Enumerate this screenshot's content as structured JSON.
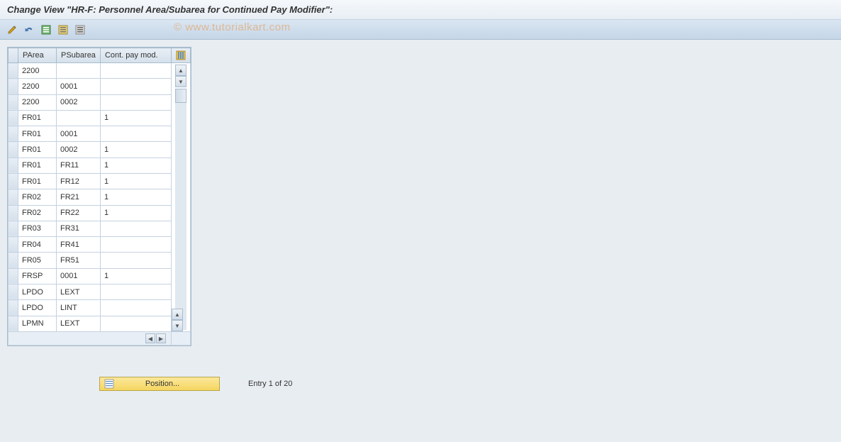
{
  "header": {
    "title": "Change View \"HR-F: Personnel Area/Subarea for Continued Pay Modifier\":"
  },
  "watermark": "© www.tutorialkart.com",
  "table": {
    "columns": {
      "parea": "PArea",
      "psubarea": "PSubarea",
      "contpay": "Cont. pay mod."
    },
    "rows": [
      {
        "parea": "2200",
        "psubarea": "",
        "contpay": ""
      },
      {
        "parea": "2200",
        "psubarea": "0001",
        "contpay": ""
      },
      {
        "parea": "2200",
        "psubarea": "0002",
        "contpay": ""
      },
      {
        "parea": "FR01",
        "psubarea": "",
        "contpay": "1"
      },
      {
        "parea": "FR01",
        "psubarea": "0001",
        "contpay": ""
      },
      {
        "parea": "FR01",
        "psubarea": "0002",
        "contpay": "1"
      },
      {
        "parea": "FR01",
        "psubarea": "FR11",
        "contpay": "1"
      },
      {
        "parea": "FR01",
        "psubarea": "FR12",
        "contpay": "1"
      },
      {
        "parea": "FR02",
        "psubarea": "FR21",
        "contpay": "1"
      },
      {
        "parea": "FR02",
        "psubarea": "FR22",
        "contpay": "1"
      },
      {
        "parea": "FR03",
        "psubarea": "FR31",
        "contpay": ""
      },
      {
        "parea": "FR04",
        "psubarea": "FR41",
        "contpay": ""
      },
      {
        "parea": "FR05",
        "psubarea": "FR51",
        "contpay": ""
      },
      {
        "parea": "FRSP",
        "psubarea": "0001",
        "contpay": "1"
      },
      {
        "parea": "LPDO",
        "psubarea": "LEXT",
        "contpay": ""
      },
      {
        "parea": "LPDO",
        "psubarea": "LINT",
        "contpay": ""
      },
      {
        "parea": "LPMN",
        "psubarea": "LEXT",
        "contpay": ""
      }
    ]
  },
  "footer": {
    "position_label": "Position...",
    "entry_text": "Entry 1 of 20"
  }
}
